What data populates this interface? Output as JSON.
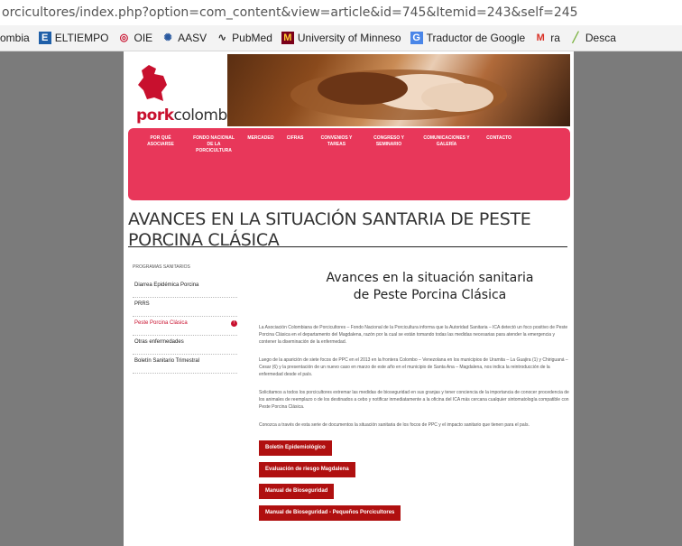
{
  "browser": {
    "url": "orcicultores/index.php?option=com_content&view=article&id=745&Itemid=243&self=245",
    "bookmarks": [
      {
        "label": "ombia",
        "icon": ""
      },
      {
        "label": "ELTIEMPO",
        "icon": "eltiempo-icon"
      },
      {
        "label": "OIE",
        "icon": "oie-icon"
      },
      {
        "label": "AASV",
        "icon": "aasv-icon"
      },
      {
        "label": "PubMed",
        "icon": "pubmed-icon"
      },
      {
        "label": "University of Minneso",
        "icon": "university-icon"
      },
      {
        "label": "Traductor de Google",
        "icon": "translate-icon"
      },
      {
        "label": "ra",
        "icon": "gmail-icon"
      },
      {
        "label": "Desca",
        "icon": "download-icon"
      }
    ]
  },
  "site": {
    "logo_pork": "pork",
    "logo_colombia": "colombia",
    "menu": [
      "Por qué asociarse",
      "Fondo Nacional de la Porcicultura",
      "Mercadeo",
      "Cifras",
      "Convenios y tareas",
      "Congreso y seminario",
      "Comunicaciones y galería",
      "Contacto"
    ],
    "page_title": "AVANCES EN LA SITUACIÓN SANTARIA DE PESTE PORCINA CLÁSICA"
  },
  "sidebar": {
    "heading": "Programas sanitarios",
    "items": [
      {
        "label": "Diarrea Epidémica Porcina",
        "active": false
      },
      {
        "label": "PRRS",
        "active": false
      },
      {
        "label": "Peste Porcina Clásica",
        "active": true
      },
      {
        "label": "Otras enfermedades",
        "active": false
      },
      {
        "label": "Boletín Sanitario Trimestral",
        "active": false
      }
    ],
    "active_badge": "!"
  },
  "article": {
    "title_line1": "Avances en la situación sanitaria",
    "title_line2": "de Peste Porcina Clásica",
    "paragraphs": [
      "La Asociación Colombiana de Porcicultores – Fondo Nacional de la Porcicultura informa que la Autoridad Sanitaria – ICA detectó un foco positivo de Peste Porcina Clásica en el departamento del Magdalena, razón por la cual se están tomando todas las medidas necesarias para atender la emergencia y contener la diseminación de la enfermedad.",
      "Luego de la aparición de siete focos de PPC en el 2013 en la frontera Colombo – Venezolana en los municipios de Uramita – La Guajira (1) y Chiriguaná – Cesar (6) y la presentación de un nuevo caso en marzo de este año en el municipio de Santa Ana – Magdalena, nos indica la reintroducción de la enfermedad desde el país.",
      "Solicitamos a todos los porcicultores extremar las medidas de bioseguridad en sus granjas y tener conciencia de la importancia de conocer procedencia de los animales de reemplazo o de los destinados a cebo y notificar inmediatamente a la oficina del ICA más cercana cualquier sintomatología compatible con Peste Porcina Clásica.",
      "Conozca a través de esta serie de documentos la situación sanitaria de los focos de PPC y el impacto sanitario que tienen para el país."
    ],
    "buttons": [
      "Boletín Epidemiológico",
      "Evaluación de riesgo Magdalena",
      "Manual de Bioseguridad",
      "Manual de Bioseguridad - Pequeños Porcicultores"
    ]
  },
  "colors": {
    "menu_bg": "#e8375a",
    "button_bg": "#b01010",
    "accent": "#c8102e"
  }
}
